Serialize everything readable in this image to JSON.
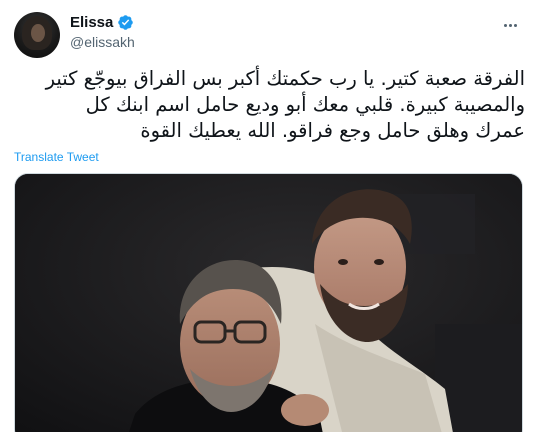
{
  "author": {
    "display_name": "Elissa",
    "handle": "@elissakh",
    "verified": true
  },
  "tweet": {
    "text_lines": [
      "الفرقة صعبة كتير. يا رب حكمتك أكبر بس الفراق بيوجّع كتير",
      "والمصيبة كبيرة. قلبي معك أبو وديع حامل اسم ابنك كل",
      "عمرك وهلق حامل وجع فراقو. الله يعطيك القوة"
    ],
    "translate_label": "Translate Tweet"
  },
  "media": {
    "alt": "photo"
  },
  "icons": {
    "verified": "verified-badge-icon",
    "more": "more-options-icon"
  },
  "colors": {
    "accent": "#1d9bf0",
    "text": "#0f1419",
    "secondary_text": "#536471"
  }
}
